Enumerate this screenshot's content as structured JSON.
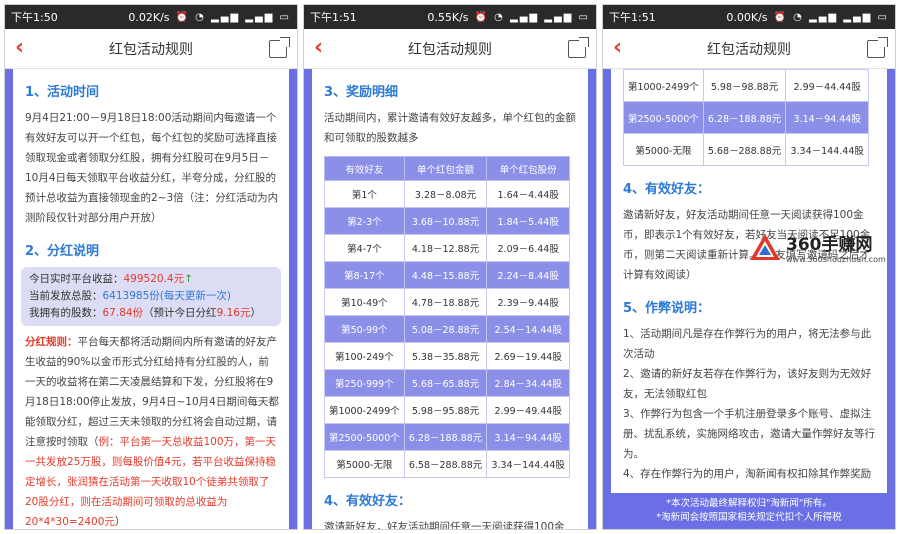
{
  "screens": [
    {
      "status": {
        "time": "下午1:50",
        "speed": "0.02K/s"
      },
      "title": "红包活动规则",
      "sec1_title": "1、活动时间",
      "sec1_text": "9月4日21:00－9月18日18:00活动期间内每邀请一个有效好友可以开一个红包，每个红包的奖励可选择直接领取现金或者领取分红股，拥有分红股可在9月5日－10月4日每天领取平台收益分红，半夸分成，分红股的预计总收益为直接领现金的2~3倍（注：分红活动为内测阶段仅针对部分用户开放）",
      "sec2_title": "2、分红说明",
      "box": {
        "line1_label": "今日实时平台收益：",
        "line1_value": "499520.4元",
        "line2_label": "当前发放总股：",
        "line2_value": "6413985份(每天更新一次)",
        "line3_label": "我拥有的股数：",
        "line3_value": "67.84份",
        "line3_mid": "（预计今日分红",
        "line3_value2": "9.16元",
        "line3_end": "）"
      },
      "rule_label": "分红规则：",
      "rule_text": "平台每天都将活动期间内所有邀请的好友产生收益的90%以金币形式分红给持有分红股的人，前一天的收益将在第二天凌晨结算和下发，分红股将在9月18日18:00停止发放，9月4日~10月4日期间每天都能领取分红，超过三天未领取的分红将会自动过期，请注意按时领取（",
      "rule_example": "例：平台第一天总收益100万，第一天一共发放25万股，则每股价值4元，若平台收益保持稳定增长，张润猜在活动第一天收取10个徒弟共领取了20股分红，则在活动期间可领取的总收益为20*4*30=2400元",
      "rule_end": "）"
    },
    {
      "status": {
        "time": "下午1:51",
        "speed": "0.55K/s"
      },
      "title": "红包活动规则",
      "sec3_title": "3、奖励明细",
      "sec3_text": "活动期间内，累计邀请有效好友越多，单个红包的金额和可领取的股数越多",
      "headers": [
        "有效好友",
        "单个红包金额",
        "单个红包股份"
      ],
      "rows": [
        [
          "第1个",
          "3.28－8.08元",
          "1.64－4.44股"
        ],
        [
          "第2-3个",
          "3.68－10.88元",
          "1.84－5.44股"
        ],
        [
          "第4-7个",
          "4.18－12.88元",
          "2.09－6.44股"
        ],
        [
          "第8-17个",
          "4.48－15.88元",
          "2.24－8.44股"
        ],
        [
          "第10-49个",
          "4.78－18.88元",
          "2.39－9.44股"
        ],
        [
          "第50-99个",
          "5.08－28.88元",
          "2.54－14.44股"
        ],
        [
          "第100-249个",
          "5.38－35.88元",
          "2.69－19.44股"
        ],
        [
          "第250-999个",
          "5.68－65.88元",
          "2.84－34.44股"
        ],
        [
          "第1000-2499个",
          "5.98－95.88元",
          "2.99－49.44股"
        ],
        [
          "第2500-5000个",
          "6.28－188.88元",
          "3.14－94.44股"
        ],
        [
          "第5000-无限",
          "6.58－288.88元",
          "3.34－144.44股"
        ]
      ],
      "sec4_title": "4、有效好友：",
      "sec4_cut": "邀请新好友，好友活动期间任意一天阅读获得100金"
    },
    {
      "status": {
        "time": "下午1:51",
        "speed": "0.00K/s"
      },
      "title": "红包活动规则",
      "rows": [
        [
          "第1000-2499个",
          "5.98－98.88元",
          "2.99－44.44股"
        ],
        [
          "第2500-5000个",
          "6.28－188.88元",
          "3.14－94.44股"
        ],
        [
          "第5000-无限",
          "5.68－288.88元",
          "3.34－144.44股"
        ]
      ],
      "sec4_title": "4、有效好友：",
      "sec4_text": "邀请新好友，好友活动期间任意一天阅读获得100金币，即表示1个有效好友，若好友当天阅读不足100金币，则第二天阅读重新计算。（好友填写邀请码之后才计算有效阅读）",
      "sec5_title": "5、作弊说明：",
      "sec5_items": [
        "1、活动期间凡是存在作弊行为的用户，将无法参与此次活动",
        "2、邀请的新好友若存在作弊行为，该好友则为无效好友，无法领取红包",
        "3、作弊行为包含一个手机注册登录多个账号、虚拟注册、扰乱系统，实施网络攻击，邀请大量作弊好友等行为。",
        "4、存在作弊行为的用户，淘新闻有权扣除其作弊奖励"
      ],
      "footer1": "*本次活动最终解释权归\"淘新闻\"所有。",
      "footer2": "*淘新闻会按照国家相关规定代扣个人所得税"
    }
  ],
  "watermark": {
    "name": "360手赚网",
    "url": "www.360shouzhuan.com"
  },
  "colors": {
    "accent": "#6b6fe6",
    "title_blue": "#2d7ad6",
    "red": "#e33a2a"
  }
}
